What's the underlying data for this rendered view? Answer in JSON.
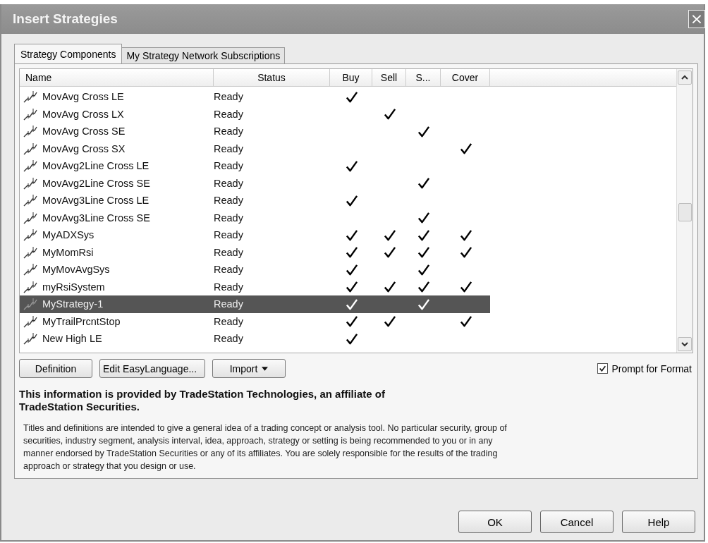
{
  "window": {
    "title": "Insert Strategies",
    "close": "×"
  },
  "tabs": [
    {
      "label": "Strategy Components",
      "selected": true
    },
    {
      "label": "My Strategy Network Subscriptions",
      "selected": false
    }
  ],
  "table": {
    "columns": [
      "Name",
      "Status",
      "Buy",
      "Sell",
      "S...",
      "Cover"
    ],
    "rows": [
      {
        "name": "MovAvg Cross LE",
        "status": "Ready",
        "buy": true,
        "sell": false,
        "short": false,
        "cover": false,
        "selected": false
      },
      {
        "name": "MovAvg Cross LX",
        "status": "Ready",
        "buy": false,
        "sell": true,
        "short": false,
        "cover": false,
        "selected": false
      },
      {
        "name": "MovAvg Cross SE",
        "status": "Ready",
        "buy": false,
        "sell": false,
        "short": true,
        "cover": false,
        "selected": false
      },
      {
        "name": "MovAvg Cross SX",
        "status": "Ready",
        "buy": false,
        "sell": false,
        "short": false,
        "cover": true,
        "selected": false
      },
      {
        "name": "MovAvg2Line Cross LE",
        "status": "Ready",
        "buy": true,
        "sell": false,
        "short": false,
        "cover": false,
        "selected": false
      },
      {
        "name": "MovAvg2Line Cross SE",
        "status": "Ready",
        "buy": false,
        "sell": false,
        "short": true,
        "cover": false,
        "selected": false
      },
      {
        "name": "MovAvg3Line Cross LE",
        "status": "Ready",
        "buy": true,
        "sell": false,
        "short": false,
        "cover": false,
        "selected": false
      },
      {
        "name": "MovAvg3Line Cross SE",
        "status": "Ready",
        "buy": false,
        "sell": false,
        "short": true,
        "cover": false,
        "selected": false
      },
      {
        "name": "MyADXSys",
        "status": "Ready",
        "buy": true,
        "sell": true,
        "short": true,
        "cover": true,
        "selected": false
      },
      {
        "name": "MyMomRsi",
        "status": "Ready",
        "buy": true,
        "sell": true,
        "short": true,
        "cover": true,
        "selected": false
      },
      {
        "name": "MyMovAvgSys",
        "status": "Ready",
        "buy": true,
        "sell": false,
        "short": true,
        "cover": false,
        "selected": false
      },
      {
        "name": "myRsiSystem",
        "status": "Ready",
        "buy": true,
        "sell": true,
        "short": true,
        "cover": true,
        "selected": false
      },
      {
        "name": "MyStrategy-1",
        "status": "Ready",
        "buy": true,
        "sell": false,
        "short": true,
        "cover": false,
        "selected": true
      },
      {
        "name": "MyTrailPrcntStop",
        "status": "Ready",
        "buy": true,
        "sell": true,
        "short": false,
        "cover": true,
        "selected": false
      },
      {
        "name": "New High LE",
        "status": "Ready",
        "buy": true,
        "sell": false,
        "short": false,
        "cover": false,
        "selected": false
      }
    ]
  },
  "buttons": [
    {
      "label": "Definition",
      "kind": "plain"
    },
    {
      "label": "Edit EasyLanguage...",
      "kind": "plain"
    },
    {
      "label": "Import",
      "kind": "menu"
    }
  ],
  "prompt_for_format": {
    "label": "Prompt for Format",
    "checked": true
  },
  "info": {
    "heading": "This information is provided by TradeStation Technologies, an affiliate of TradeStation Securities.",
    "text": "Titles and definitions are intended to give a general idea of a trading concept or analysis tool. No particular security, group of securities, industry segment, analysis interval, idea, approach, strategy or setting is being recommended to you or in any manner endorsed by TradeStation Securities or any of its affiliates. You are solely responsible for the results of the trading approach or strategy that you design or use."
  },
  "footer_buttons": [
    "OK",
    "Cancel",
    "Help"
  ]
}
